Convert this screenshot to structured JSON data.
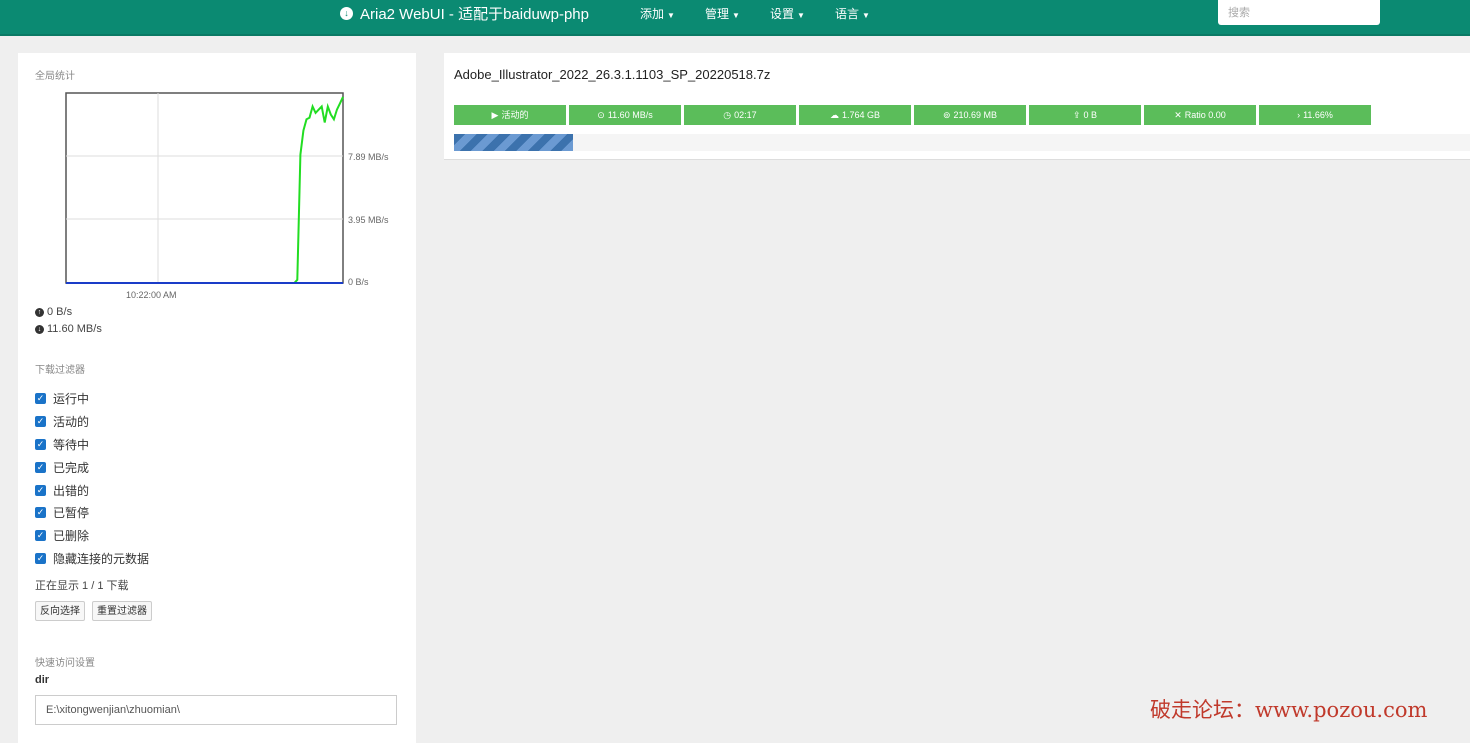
{
  "nav": {
    "brand": "Aria2 WebUI - 适配于baiduwp-php",
    "menus": [
      "添加",
      "管理",
      "设置",
      "语言"
    ],
    "search_placeholder": "搜索"
  },
  "sidebar": {
    "stats_title": "全局统计",
    "upload_rate": "0 B/s",
    "download_rate": "11.60 MB/s",
    "filter_title": "下载过滤器",
    "filters": [
      "运行中",
      "活动的",
      "等待中",
      "已完成",
      "出错的",
      "已暂停",
      "已删除",
      "隐藏连接的元数据"
    ],
    "showing": "正在显示 1 / 1 下载",
    "btn_invert": "反向选择",
    "btn_reset": "重置过滤器",
    "quick_title": "快速访问设置",
    "dir_label": "dir",
    "dir_value": "E:\\xitongwenjian\\zhuomian\\"
  },
  "chart_data": {
    "type": "line",
    "x_tick_labels": [
      "10:22:00 AM"
    ],
    "y_tick_labels": [
      "7.89 MB/s",
      "3.95 MB/s",
      "0 B/s"
    ],
    "ylim": [
      0,
      11.84
    ],
    "grid": true,
    "series": [
      {
        "color": "#22dd22",
        "values": [
          0,
          0,
          0,
          0,
          0,
          0,
          0,
          0,
          0,
          0,
          0,
          0,
          0,
          0,
          0,
          0,
          0,
          0,
          0,
          0,
          0,
          0,
          0,
          0,
          0,
          0,
          0,
          0,
          0,
          0,
          0,
          0,
          0,
          0,
          0,
          0,
          0,
          0,
          0,
          0,
          0,
          0,
          0,
          0,
          0,
          0,
          0,
          0,
          0,
          0,
          0,
          0,
          0,
          0,
          0,
          0,
          0,
          0,
          0,
          0,
          0,
          0,
          0,
          0,
          0,
          0,
          0,
          0,
          0,
          0,
          0,
          0,
          0,
          0,
          0,
          0,
          0.2,
          8.0,
          9.5,
          10.2,
          10.3,
          11.0,
          10.6,
          10.8,
          11.0,
          10.0,
          11.0,
          10.5,
          10.2,
          10.8,
          11.2,
          11.6
        ]
      },
      {
        "color": "#1a3cc8",
        "values": [
          0,
          0,
          0,
          0,
          0,
          0,
          0,
          0,
          0,
          0,
          0,
          0,
          0,
          0,
          0,
          0,
          0,
          0,
          0,
          0,
          0,
          0,
          0,
          0,
          0,
          0,
          0,
          0,
          0,
          0,
          0,
          0,
          0,
          0,
          0,
          0,
          0,
          0,
          0,
          0,
          0,
          0,
          0,
          0,
          0,
          0,
          0,
          0,
          0,
          0,
          0,
          0,
          0,
          0,
          0,
          0,
          0,
          0,
          0,
          0,
          0,
          0,
          0,
          0,
          0,
          0,
          0,
          0,
          0,
          0,
          0,
          0,
          0,
          0,
          0,
          0,
          0,
          0,
          0,
          0,
          0,
          0,
          0,
          0,
          0,
          0,
          0,
          0,
          0,
          0,
          0,
          0
        ]
      }
    ]
  },
  "download": {
    "filename": "Adobe_Illustrator_2022_26.3.1.1103_SP_20220518.7z",
    "badges": [
      {
        "icon": "▶",
        "text": "活动的"
      },
      {
        "icon": "⊙",
        "text": "11.60 MB/s"
      },
      {
        "icon": "◷",
        "text": "02:17"
      },
      {
        "icon": "☁",
        "text": "1.764 GB"
      },
      {
        "icon": "⊚",
        "text": "210.69 MB"
      },
      {
        "icon": "⇪",
        "text": "0 B"
      },
      {
        "icon": "✕",
        "text": "Ratio 0.00"
      },
      {
        "icon": "›",
        "text": "11.66%"
      }
    ],
    "progress": 0.1166
  },
  "watermark": "破走论坛：www.pozou.com"
}
